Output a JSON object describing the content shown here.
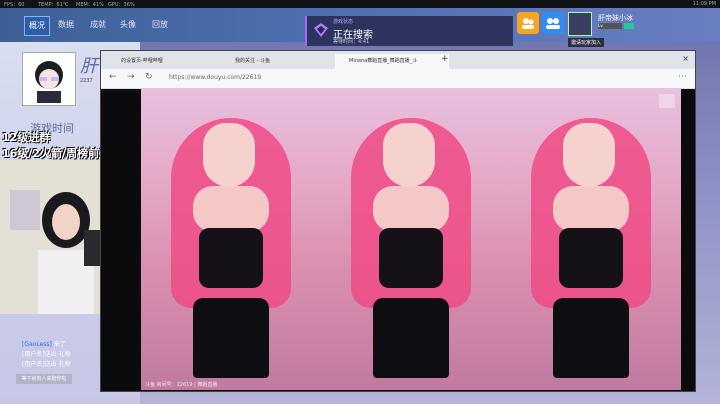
{
  "status": {
    "fps": "FPS：60",
    "temp": "TEMP：61℃",
    "mem": "MEM：41%",
    "gpu": "GPU：36%",
    "clock": "11:09 PM"
  },
  "nav_tabs": [
    "概况",
    "数据",
    "成就",
    "头像",
    "回放"
  ],
  "notification": {
    "small": "游戏状态",
    "title": "正在搜索",
    "time": "等待时间：4:41"
  },
  "user": {
    "name": "肝帝妹小冰",
    "level": "Lv.",
    "tip": "邀请玩家加入"
  },
  "left": {
    "big_char": "肝",
    "number": "2237",
    "game_time": "游戏时间",
    "tag1": "12级进群",
    "tag2": "16级/2火箭/周榜前三房管"
  },
  "chat": [
    {
      "user": "[GaoLess]",
      "msg": "来了"
    },
    {
      "user": "",
      "msg": "[用户名]送出 礼物"
    },
    {
      "user": "",
      "msg": "[用户名]送出 礼物"
    }
  ],
  "link_button": "等下就有人来陪你啦",
  "browser": {
    "tabs": [
      "的设置页-哔哩哔哩",
      "我的关注 - 斗鱼",
      "Minana舞蹈直播_舞蹈直播_斗"
    ],
    "url": "https://www.douyu.com/22619",
    "caption": "斗鱼 房间号：22619 | 舞蹈直播"
  },
  "colors": {
    "nav_active": "#2f5da8",
    "accent_purple": "#a866ff",
    "yellow_btn": "#f5a623",
    "blue_btn": "#2f8ef0"
  }
}
